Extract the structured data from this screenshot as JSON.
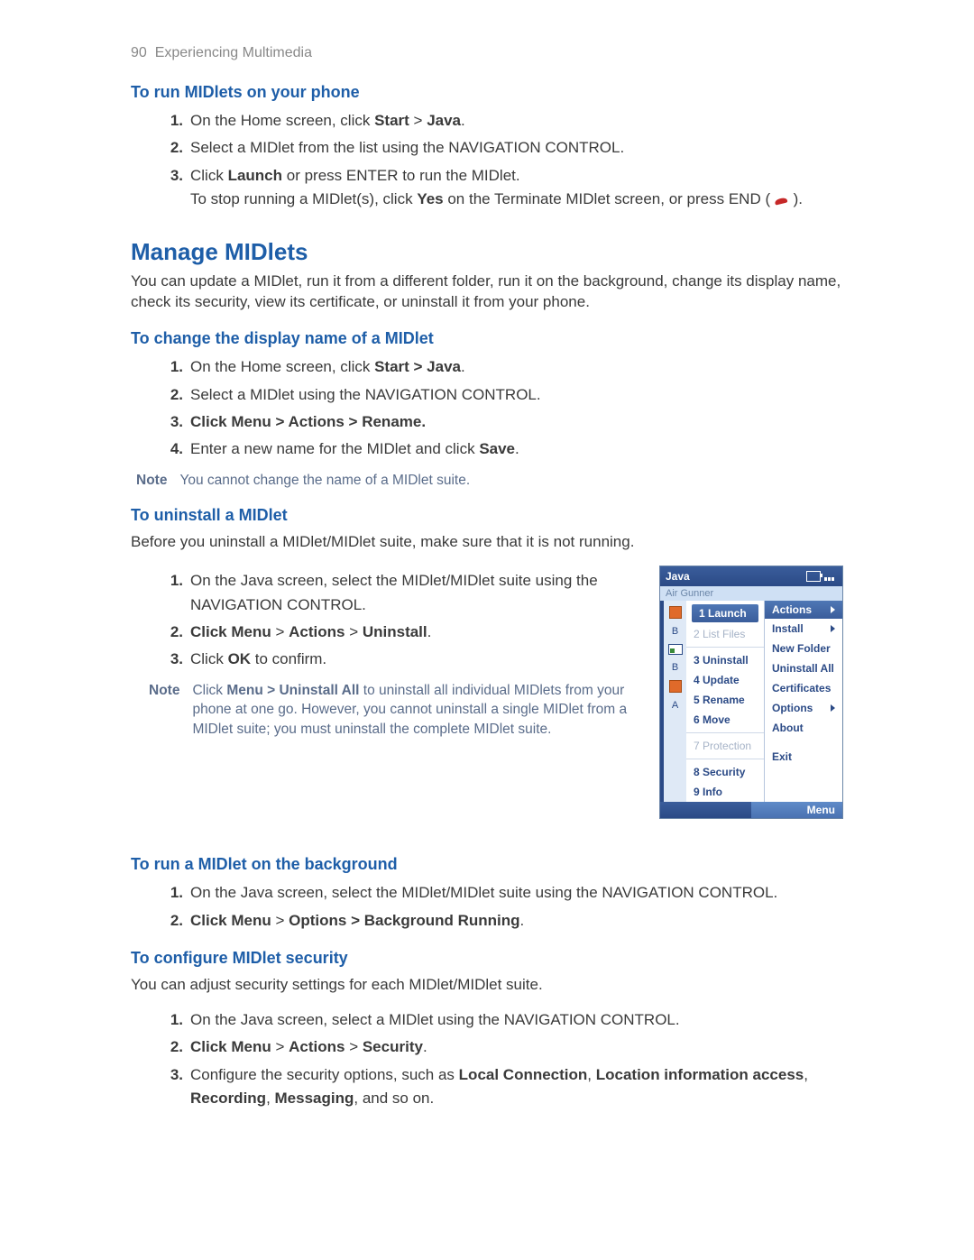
{
  "header": {
    "page_number": "90",
    "chapter": "Experiencing Multimedia"
  },
  "sec1": {
    "title": "To run MIDlets on your phone",
    "s1_pre": "On the Home screen, click ",
    "s1_b1": "Start",
    "s1_gt": " > ",
    "s1_b2": "Java",
    "s1_post": ".",
    "s2": "Select a MIDlet from the list using the NAVIGATION CONTROL.",
    "s3_pre": "Click ",
    "s3_b": "Launch",
    "s3_post": " or press ENTER to run the MIDlet.",
    "s3b_pre": "To stop running a MIDlet(s), click ",
    "s3b_b": "Yes",
    "s3b_mid": " on the Terminate MIDlet screen, or press END ( ",
    "s3b_post": " )."
  },
  "manage": {
    "title": "Manage MIDlets",
    "para": "You can update a MIDlet,  run it from a different folder, run it on the background, change its display name, check its security, view its certificate, or uninstall it from your phone."
  },
  "sec2": {
    "title": "To change the display name of a MIDlet",
    "s1_pre": "On the Home screen, click ",
    "s1_b": "Start > Java",
    "s1_post": ".",
    "s2": "Select a MIDlet using the NAVIGATION CONTROL.",
    "s3_pre": "Click ",
    "s3_b": "Menu > Actions > Rename",
    "s3_post": ".",
    "s4_pre": "Enter a new name for the MIDlet and click ",
    "s4_b": "Save",
    "s4_post": ".",
    "note_label": "Note",
    "note_text": "You cannot change the name of a MIDlet suite."
  },
  "sec3": {
    "title": "To uninstall a MIDlet",
    "intro": "Before you uninstall a MIDlet/MIDlet suite, make sure that it is not running.",
    "s1": "On the Java screen, select the MIDlet/MIDlet suite using the NAVIGATION CONTROL.",
    "s2_pre": "Click ",
    "s2_b1": "Menu",
    "s2_gt": " > ",
    "s2_b2": "Actions",
    "s2_b3": "Uninstall",
    "s2_post": ".",
    "s3_pre": "Click ",
    "s3_b": "OK",
    "s3_post": " to confirm.",
    "note_label": "Note",
    "note_pre": "Click ",
    "note_b": "Menu > Uninstall All",
    "note_post": " to uninstall all individual MIDlets from your phone at one go. However, you cannot uninstall a single MIDlet from a MIDlet suite; you must uninstall the complete MIDlet suite."
  },
  "phone": {
    "title": "Java",
    "toprow": "Air Gunner",
    "left_letters": [
      "B",
      "B",
      "A"
    ],
    "menu1": [
      "1 Launch",
      "2 List Files",
      "3 Uninstall",
      "4 Update",
      "5 Rename",
      "6 Move",
      "7 Protection",
      "8 Security",
      "9 Info"
    ],
    "menu1_disabled": [
      1,
      6
    ],
    "menu2_head": "Actions",
    "menu2": [
      "Install",
      "New Folder",
      "Uninstall All",
      "Certificates",
      "Options",
      "About",
      "Exit"
    ],
    "menu2_sub": [
      0,
      4
    ],
    "footer_left": "",
    "footer_right": "Menu"
  },
  "sec4": {
    "title": "To run a MIDlet on the background",
    "s1": "On the Java screen, select the MIDlet/MIDlet suite using the NAVIGATION CONTROL.",
    "s2_pre": "Click ",
    "s2_b1": "Menu",
    "s2_gt": " > ",
    "s2_b2": "Options > Background Running",
    "s2_post": "."
  },
  "sec5": {
    "title": "To configure MIDlet security",
    "intro": "You can adjust security settings for each MIDlet/MIDlet suite.",
    "s1": "On the Java screen, select a MIDlet using the NAVIGATION CONTROL.",
    "s2_pre": "Click ",
    "s2_b1": "Menu",
    "s2_gt": " > ",
    "s2_b2": "Actions",
    "s2_b3": "Security",
    "s2_post": ".",
    "s3_pre": "Configure the security options, such as ",
    "s3_b1": "Local Connection",
    "s3_b2": "Location information access",
    "s3_b3": "Recording",
    "s3_b4": "Messaging",
    "s3_post": ", and so on."
  },
  "nums": {
    "n1": "1.",
    "n2": "2.",
    "n3": "3.",
    "n4": "4."
  }
}
